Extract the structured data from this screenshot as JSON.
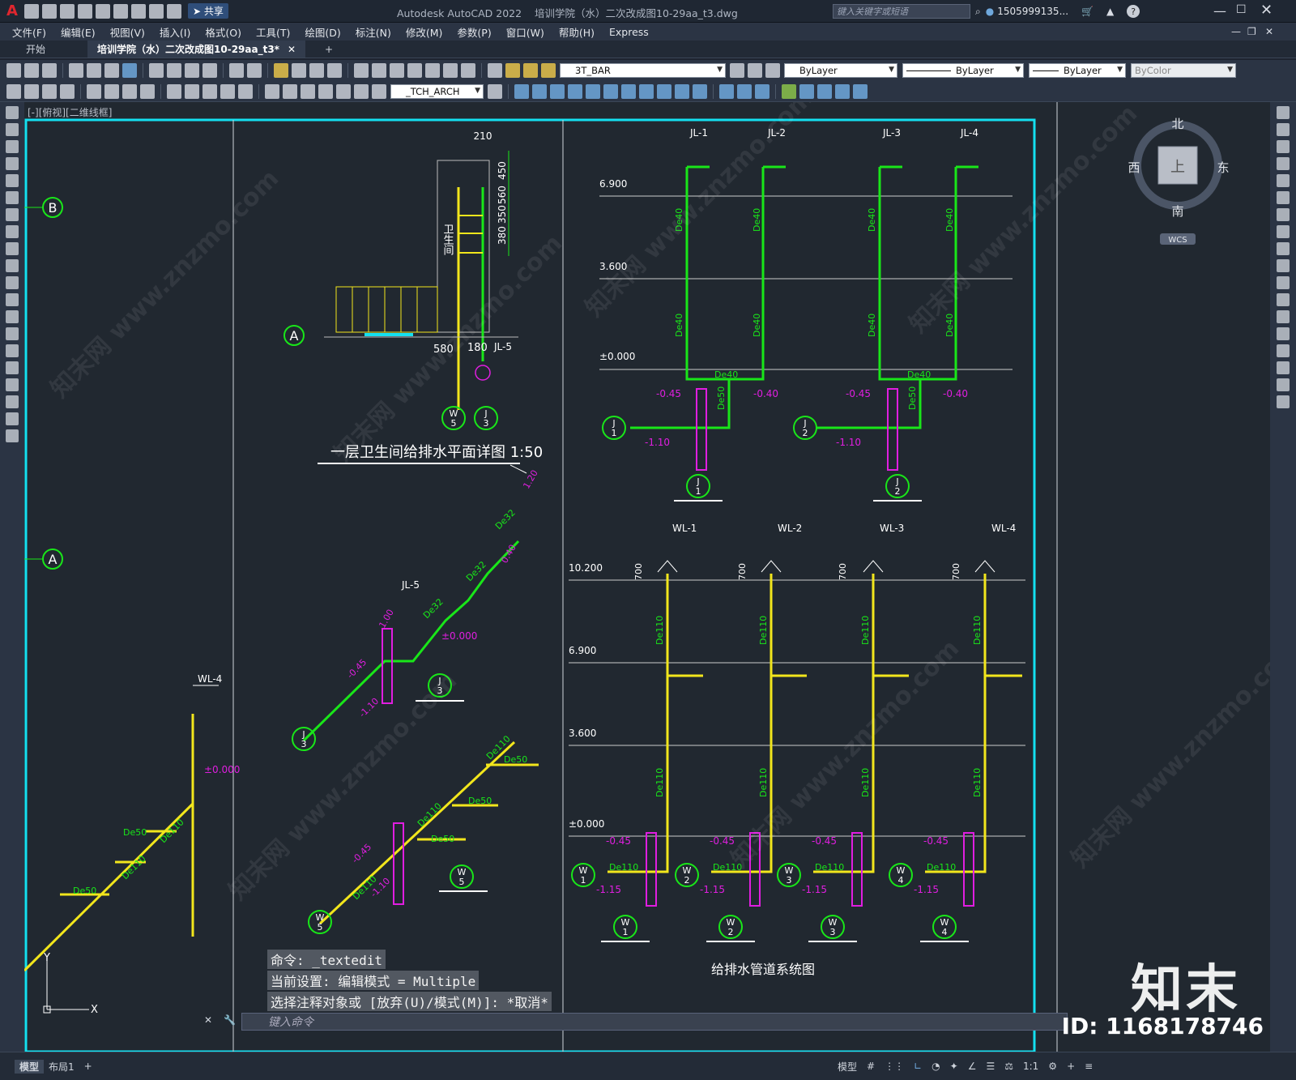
{
  "titlebar": {
    "app_name": "Autodesk AutoCAD 2022",
    "file_name": "培训学院（水）二次改成图10-29aa_t3.dwg",
    "share_label": "共享",
    "search_placeholder": "键入关键字或短语",
    "user": "1505999135..."
  },
  "menu": [
    "文件(F)",
    "编辑(E)",
    "视图(V)",
    "插入(I)",
    "格式(O)",
    "工具(T)",
    "绘图(D)",
    "标注(N)",
    "修改(M)",
    "参数(P)",
    "窗口(W)",
    "帮助(H)",
    "Express"
  ],
  "tabs": {
    "start": "开始",
    "doc": "培训学院（水）二次改成图10-29aa_t3*"
  },
  "toolbar": {
    "layer": "3T_BAR",
    "color": "ByLayer",
    "linetype": "ByLayer",
    "lineweight": "ByLayer",
    "plotstyle": "ByColor",
    "textstyle": "_TCH_ARCH"
  },
  "viewport_label": "[-][俯视][二维线框]",
  "viewcube": {
    "north": "北",
    "south": "南",
    "east": "东",
    "west": "西",
    "top": "上",
    "wcs": "WCS"
  },
  "drawing": {
    "plan_title": "一层卫生间给排水平面详图 1:50",
    "system_title": "给排水管道系统图",
    "room": "卫生间",
    "axis_b": "B",
    "axis_a": "A",
    "dims": [
      "210",
      "450",
      "560",
      "350",
      "380",
      "580",
      "180"
    ],
    "jl5": "JL-5",
    "jl_labels": [
      "JL-1",
      "JL-2",
      "JL-3",
      "JL-4"
    ],
    "wl_labels": [
      "WL-1",
      "WL-2",
      "WL-3",
      "WL-4"
    ],
    "elev_j": [
      "6.900",
      "3.600",
      "±0.000"
    ],
    "elev_w": [
      "10.200",
      "6.900",
      "3.600",
      "±0.000"
    ],
    "de40": "De40",
    "de50": "De50",
    "de32": "De32",
    "de110": "De110",
    "minus045": "-0.45",
    "minus040": "-0.40",
    "minus110": "-1.10",
    "minus115": "-1.15",
    "d700": "700",
    "pm0": "±0.000",
    "d100": "1.00",
    "d120": "1.20",
    "d040": "0.40",
    "wl4": "WL-4",
    "j": [
      "J",
      "1",
      "2",
      "3"
    ],
    "w": [
      "W",
      "1",
      "2",
      "3",
      "4",
      "5"
    ]
  },
  "command": {
    "line1": "命令: _textedit",
    "line2": "当前设置: 编辑模式 = Multiple",
    "line3": "选择注释对象或 [放弃(U)/模式(M)]: *取消*",
    "input_placeholder": "键入命令"
  },
  "layout_tabs": {
    "model": "模型",
    "layout1": "布局1"
  },
  "statusbar": {
    "model": "模型",
    "scale": "1:1"
  },
  "watermark": {
    "text": "知末网 www.znzmo.com",
    "brand": "知末",
    "id": "ID: 1168178746"
  }
}
